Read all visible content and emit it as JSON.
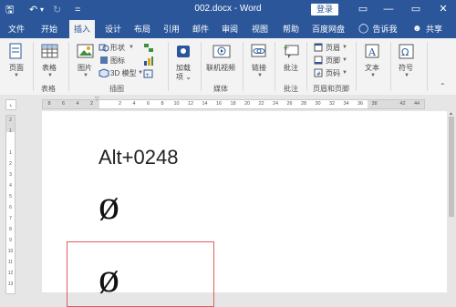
{
  "window": {
    "title": "002.docx - Word",
    "login": "登录"
  },
  "title_controls": {
    "minimize": "—",
    "restore": "▭",
    "close": "✕",
    "ribbon_display": "▭"
  },
  "quick_access": {
    "save": "🖫",
    "undo": "↶",
    "undo_dropdown": "▾",
    "redo": "↻",
    "customize": "="
  },
  "tabs": [
    "文件",
    "开始",
    "插入",
    "设计",
    "布局",
    "引用",
    "邮件",
    "审阅",
    "视图",
    "帮助",
    "百度网盘"
  ],
  "tell_me": "告诉我",
  "share": "共享",
  "ribbon": {
    "pages": "页面",
    "table": "表格",
    "pictures": "图片",
    "shapes": "形状",
    "icons": "图标",
    "model3d": "3D 模型",
    "addins": "加载项",
    "online_video": "联机视频",
    "link": "链接",
    "comment": "批注",
    "header": "页眉",
    "footer": "页脚",
    "page_number": "页码",
    "textbox": "文本",
    "symbol": "符号",
    "groups": {
      "tables": "表格",
      "illustrations": "插图",
      "media": "媒体",
      "comments": "批注",
      "header_footer": "页眉和页脚"
    }
  },
  "ruler": {
    "h_ticks": [
      "8",
      "6",
      "4",
      "2",
      "",
      "2",
      "4",
      "6",
      "8",
      "10",
      "12",
      "14",
      "16",
      "18",
      "20",
      "22",
      "24",
      "26",
      "28",
      "30",
      "32",
      "34",
      "36",
      "38",
      "",
      "42",
      "44"
    ],
    "v_ticks": [
      "2",
      "1",
      "",
      "1",
      "2",
      "3",
      "4",
      "5",
      "6",
      "7",
      "8",
      "9",
      "10",
      "11",
      "12",
      "13"
    ]
  },
  "document": {
    "heading": "Alt+0248",
    "symbol1": "ø",
    "symbol2": "ø"
  },
  "colors": {
    "accent": "#2b579a",
    "box_border": "#e05c5c"
  }
}
